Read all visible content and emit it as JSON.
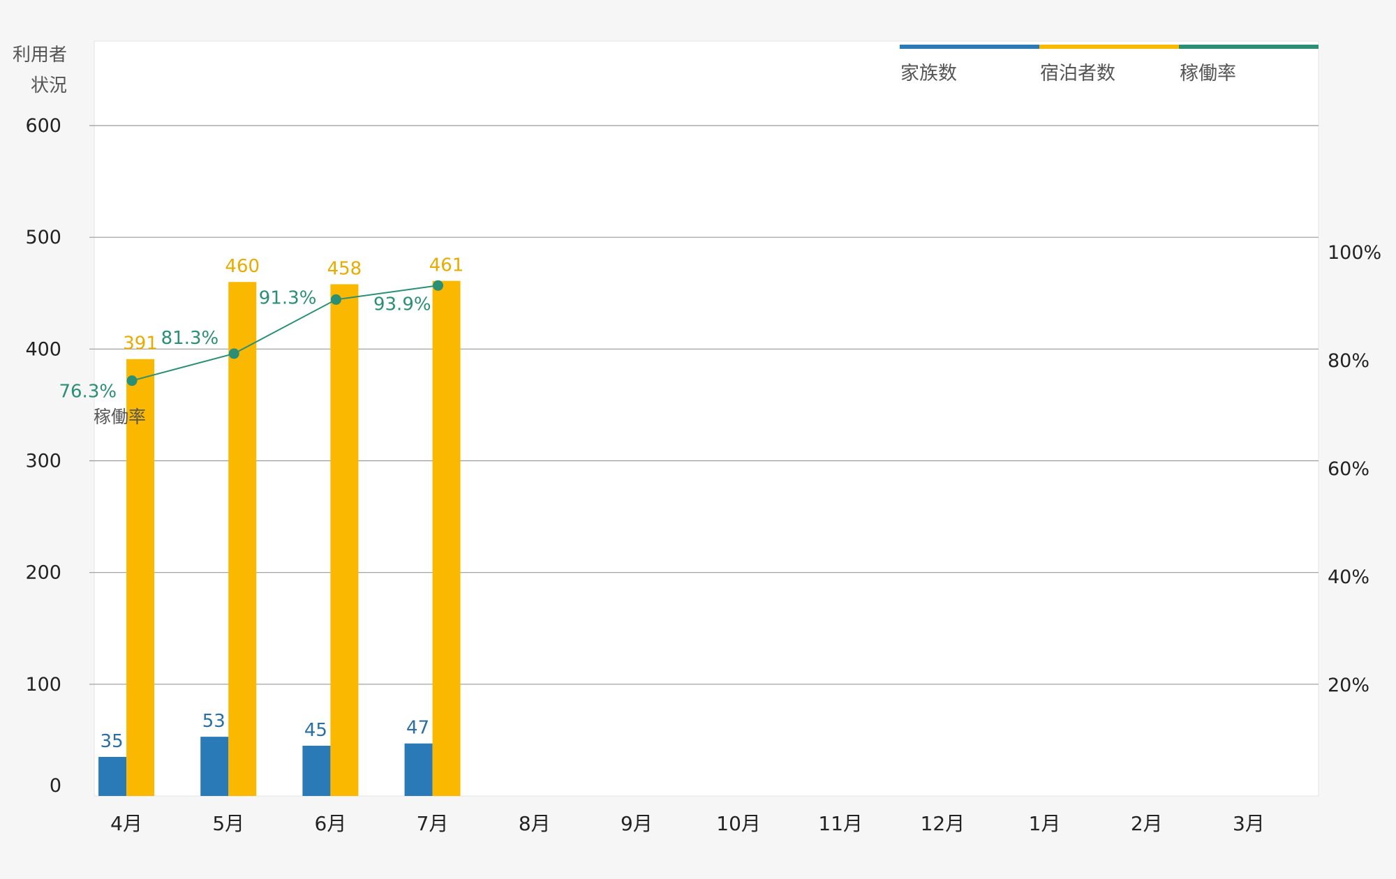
{
  "chart_data": {
    "type": "bar",
    "ylabel_left": [
      "利用者",
      "状況"
    ],
    "ylabel_right": "稼働率",
    "categories": [
      "4月",
      "5月",
      "6月",
      "7月",
      "8月",
      "9月",
      "10月",
      "11月",
      "12月",
      "1月",
      "2月",
      "3月"
    ],
    "series": [
      {
        "name": "家族数",
        "type": "bar",
        "axis": "left",
        "color": "#2a7ab8",
        "label_color": "#2a6f9f",
        "values": [
          35,
          53,
          45,
          47,
          null,
          null,
          null,
          null,
          null,
          null,
          null,
          null
        ]
      },
      {
        "name": "宿泊者数",
        "type": "bar",
        "axis": "left",
        "color": "#fbb800",
        "label_color": "#e8ab00",
        "values": [
          391,
          460,
          458,
          461,
          null,
          null,
          null,
          null,
          null,
          null,
          null,
          null
        ]
      },
      {
        "name": "稼働率",
        "type": "line",
        "axis": "right",
        "color": "#2a8f74",
        "values": [
          76.3,
          81.3,
          91.3,
          93.9,
          null,
          null,
          null,
          null,
          null,
          null,
          null,
          null
        ]
      }
    ],
    "ylim_left": [
      0,
      600
    ],
    "yticks_left": [
      0,
      100,
      200,
      300,
      400,
      500,
      600
    ],
    "ytick_labels_left": [
      "0",
      "100",
      "200",
      "300",
      "400",
      "500",
      "600"
    ],
    "ylim_right": [
      0,
      109
    ],
    "yticks_right": [
      20,
      40,
      60,
      80,
      100
    ],
    "ytick_labels_right": [
      "20%",
      "40%",
      "60%",
      "80%",
      "100%"
    ],
    "line_labels": [
      "76.3%",
      "81.3%",
      "91.3%",
      "93.9%"
    ],
    "legend": [
      "家族数",
      "宿泊者数",
      "稼働率"
    ],
    "legend_position": "top-right",
    "grid": true
  }
}
